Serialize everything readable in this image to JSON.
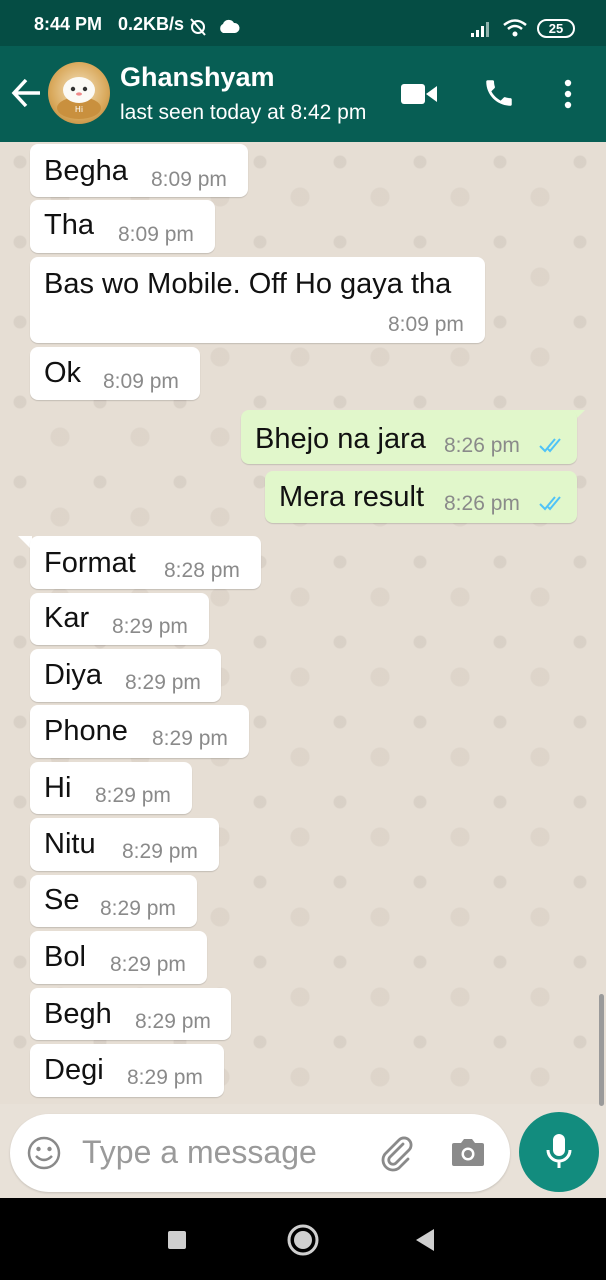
{
  "status_bar": {
    "time": "8:44 PM",
    "network_speed": "0.2KB/s",
    "battery": "25"
  },
  "header": {
    "contact_name": "Ghanshyam",
    "last_seen": "last seen today at 8:42 pm",
    "avatar_text": "Hi"
  },
  "messages": [
    {
      "dir": "in",
      "text": "Begha",
      "time": "8:09 pm"
    },
    {
      "dir": "in",
      "text": "Tha",
      "time": "8:09 pm"
    },
    {
      "dir": "in",
      "text": "Bas wo Mobile. Off Ho gaya tha",
      "time": "8:09 pm"
    },
    {
      "dir": "in",
      "text": "Ok",
      "time": "8:09 pm"
    },
    {
      "dir": "out",
      "text": "Bhejo na jara",
      "time": "8:26 pm"
    },
    {
      "dir": "out",
      "text": "Mera result",
      "time": "8:26 pm"
    },
    {
      "dir": "in",
      "text": "Format",
      "time": "8:28 pm"
    },
    {
      "dir": "in",
      "text": "Kar",
      "time": "8:29 pm"
    },
    {
      "dir": "in",
      "text": "Diya",
      "time": "8:29 pm"
    },
    {
      "dir": "in",
      "text": "Phone",
      "time": "8:29 pm"
    },
    {
      "dir": "in",
      "text": "Hi",
      "time": "8:29 pm"
    },
    {
      "dir": "in",
      "text": "Nitu",
      "time": "8:29 pm"
    },
    {
      "dir": "in",
      "text": "Se",
      "time": "8:29 pm"
    },
    {
      "dir": "in",
      "text": "Bol",
      "time": "8:29 pm"
    },
    {
      "dir": "in",
      "text": "Begh",
      "time": "8:29 pm"
    },
    {
      "dir": "in",
      "text": "Degi",
      "time": "8:29 pm"
    }
  ],
  "composer": {
    "placeholder": "Type a message"
  },
  "colors": {
    "header": "#075e54",
    "status_bar": "#054d44",
    "outgoing_bubble": "#e1f7cb",
    "incoming_bubble": "#ffffff",
    "read_ticks": "#4fc3f7",
    "mic_button": "#128c7e"
  },
  "icons": [
    "back-arrow-icon",
    "video-call-icon",
    "phone-icon",
    "more-options-icon",
    "emoji-icon",
    "attach-icon",
    "camera-icon",
    "mic-icon",
    "read-ticks-icon",
    "nav-recents-icon",
    "nav-home-icon",
    "nav-back-icon"
  ]
}
